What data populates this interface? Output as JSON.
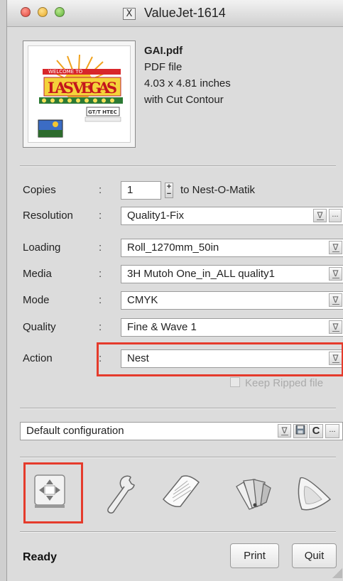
{
  "window": {
    "title": "ValueJet-1614",
    "app_icon": "X"
  },
  "file": {
    "name": "GAI.pdf",
    "type": "PDF file",
    "size": "4.03 x 4.81 inches",
    "note": "with Cut Contour",
    "thumbnail_icon": "las-vegas-graphic-thumbnail"
  },
  "copies": {
    "label": "Copies",
    "value": "1",
    "note": "to Nest-O-Matik"
  },
  "fields": [
    {
      "label": "Resolution",
      "value": "Quality1-Fix"
    },
    {
      "label": "Loading",
      "value": "Roll_1270mm_50in"
    },
    {
      "label": "Media",
      "value": "3H Mutoh One_in_ALL quality1"
    },
    {
      "label": "Mode",
      "value": "CMYK"
    },
    {
      "label": "Quality",
      "value": "Fine & Wave 1"
    },
    {
      "label": "Action",
      "value": "Nest"
    }
  ],
  "colon": ":",
  "keep_ripped": {
    "label": "Keep Ripped file",
    "checked": false
  },
  "configuration": {
    "value": "Default configuration"
  },
  "more_label": "...",
  "tools": [
    "move-layout-icon",
    "wrench-icon",
    "paper-media-icon",
    "color-swatch-icon",
    "color-profile-icon"
  ],
  "status": "Ready",
  "buttons": {
    "print": "Print",
    "quit": "Quit"
  },
  "colors": {
    "highlight": "#e53b2c",
    "window_bg": "#dcdcdc"
  }
}
